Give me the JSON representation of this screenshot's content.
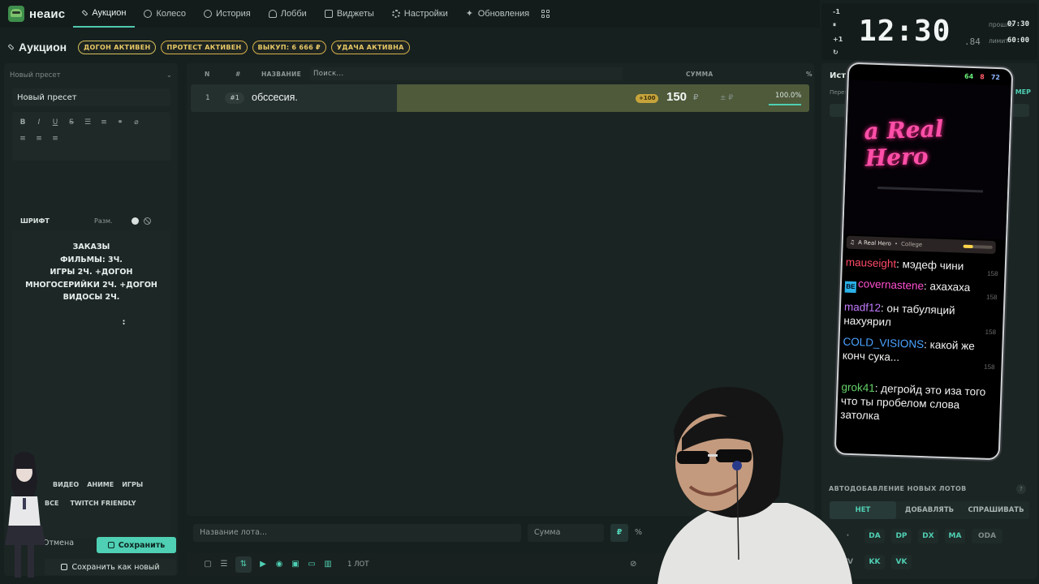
{
  "app": {
    "logo_text": "неаис"
  },
  "nav": {
    "items": [
      {
        "label": "Аукцион",
        "icon": "hammer-icon",
        "active": true
      },
      {
        "label": "Колесо",
        "icon": "wheel-icon"
      },
      {
        "label": "История",
        "icon": "history-icon"
      },
      {
        "label": "Лобби",
        "icon": "users-icon"
      },
      {
        "label": "Виджеты",
        "icon": "widgets-icon"
      },
      {
        "label": "Настройки",
        "icon": "gear-icon"
      },
      {
        "label": "Обновления",
        "icon": "sparkle-icon"
      }
    ]
  },
  "header": {
    "title": "Аукцион",
    "badges": [
      "ДОГОН АКТИВЕН",
      "ПРОТЕСТ АКТИВЕН",
      "ВЫКУП: 6 666 ₽",
      "УДАЧА АКТИВНА"
    ]
  },
  "left": {
    "preset_select": "Новый пресет",
    "preset_name": "Новый пресет",
    "font_label": "ШРИФТ",
    "size_label": "Разм.",
    "editor_lines": [
      "ЗАКАЗЫ",
      "ФИЛЬМЫ: 3Ч.",
      "ИГРЫ 2Ч. +ДОГОН",
      "МНОГОСЕРИЙКИ 2Ч. +ДОГОН",
      "ВИДОСЫ 2Ч.",
      "",
      ":"
    ],
    "tags_row1": [
      "ВИДЕО",
      "АНИМЕ",
      "ИГРЫ"
    ],
    "tags_row2": [
      "ВСЕ",
      "TWITCH FRIENDLY"
    ],
    "cancel": "Отмена",
    "save": "Сохранить",
    "save_new": "Сохранить как новый"
  },
  "table": {
    "col_n": "N",
    "col_hash": "#",
    "col_name": "НАЗВАНИЕ",
    "search_placeholder": "Поиск...",
    "col_sum": "СУММА",
    "col_pct": "%",
    "rows": [
      {
        "n": "1",
        "idx": "#1",
        "name": "обссесия.",
        "plus": "+100",
        "amount": "150",
        "currency": "₽",
        "pm": "± ₽",
        "percent": "100.0%",
        "fill": 1.0
      }
    ]
  },
  "add": {
    "name_placeholder": "Название лота...",
    "sum_placeholder": "Сумма",
    "currency": "₽",
    "pct": "%"
  },
  "bottom": {
    "lots_count": "1 ЛОТ"
  },
  "timer": {
    "minus": "-1",
    "pause": "⏸",
    "plus": "+1",
    "reset": "↻",
    "time": "12:30",
    "ms": ".84",
    "elapsed_label": "прошло",
    "elapsed": "07:30",
    "limit_label": "лимит",
    "limit": "60:00"
  },
  "right": {
    "title": "Истор",
    "sub": "Переп",
    "link": "МЕР",
    "auto_title": "АВТОДОБАВЛЕНИЕ НОВЫХ ЛОТОВ",
    "auto_help": "?",
    "auto_tabs": [
      "НЕТ",
      "ДОБАВЛЯТЬ",
      "СПРАШИВАТЬ"
    ],
    "services_row1": [
      "DA",
      "DP",
      "DX",
      "MA",
      "ODA"
    ],
    "services_row2": [
      "TV",
      "KK",
      "VK"
    ]
  },
  "phone": {
    "status": {
      "kick": "64",
      "yt": "8",
      "viewers": "72"
    },
    "art_title": "a Real Hero",
    "track": "A Real Hero",
    "artist": "College",
    "chat": [
      {
        "user": "mauseight",
        "text": ": мэдеф чини",
        "time": "158",
        "cls": "u1"
      },
      {
        "user": "covernastene",
        "text": ": ахахаха",
        "time": "158",
        "cls": "u2",
        "badge": "BE"
      },
      {
        "user": "madf12",
        "text": ": он табуляций нахуярил",
        "time": "158",
        "cls": "u3"
      },
      {
        "user": "COLD_VISIONS",
        "text": ": какой же конч сука...",
        "time": "158",
        "cls": "u4"
      },
      {
        "user": "grok41",
        "text": ": дегройд это иза того что ты пробелом слова затолка",
        "time": "",
        "cls": "u5"
      }
    ]
  }
}
